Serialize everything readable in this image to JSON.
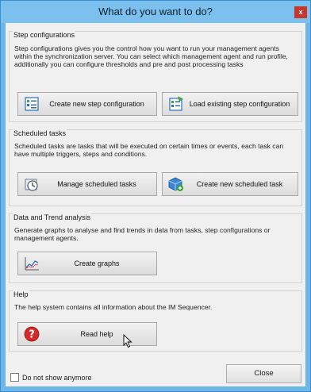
{
  "window": {
    "title": "What do you want to do?",
    "close_glyph": "x"
  },
  "groups": [
    {
      "title": "Step configurations",
      "description": "Step configurations gives you the control how you want to run your management agents within the synchronization server. You can select which management agent and run profile, additionally you can configure thresholds and pre and post processing tasks",
      "buttons": [
        {
          "label": "Create new step configuration",
          "icon": "new-config-icon"
        },
        {
          "label": "Load existing step configuration",
          "icon": "load-config-icon"
        }
      ]
    },
    {
      "title": "Scheduled tasks",
      "description": "Scheduled tasks are tasks that will be executed on certain times or events, each task can have multiple triggers, steps and conditions.",
      "buttons": [
        {
          "label": "Manage scheduled tasks",
          "icon": "clock-icon"
        },
        {
          "label": "Create new scheduled task",
          "icon": "cube-add-icon"
        }
      ]
    },
    {
      "title": "Data and Trend analysis",
      "description": "Generate graphs to analyse and find trends in data from tasks, step configurations or management agents.",
      "buttons": [
        {
          "label": "Create graphs",
          "icon": "graph-icon"
        }
      ]
    },
    {
      "title": "Help",
      "description": "The help system contains all information about the IM Sequencer.",
      "buttons": [
        {
          "label": "Read help",
          "icon": "help-icon"
        }
      ]
    }
  ],
  "footer": {
    "checkbox_label": "Do not show anymore",
    "checkbox_checked": false,
    "close_label": "Close"
  },
  "colors": {
    "window_frame": "#6fb6e8",
    "close_button": "#c9372c",
    "help_red": "#d42a2a",
    "accent_green": "#3aa63a"
  }
}
